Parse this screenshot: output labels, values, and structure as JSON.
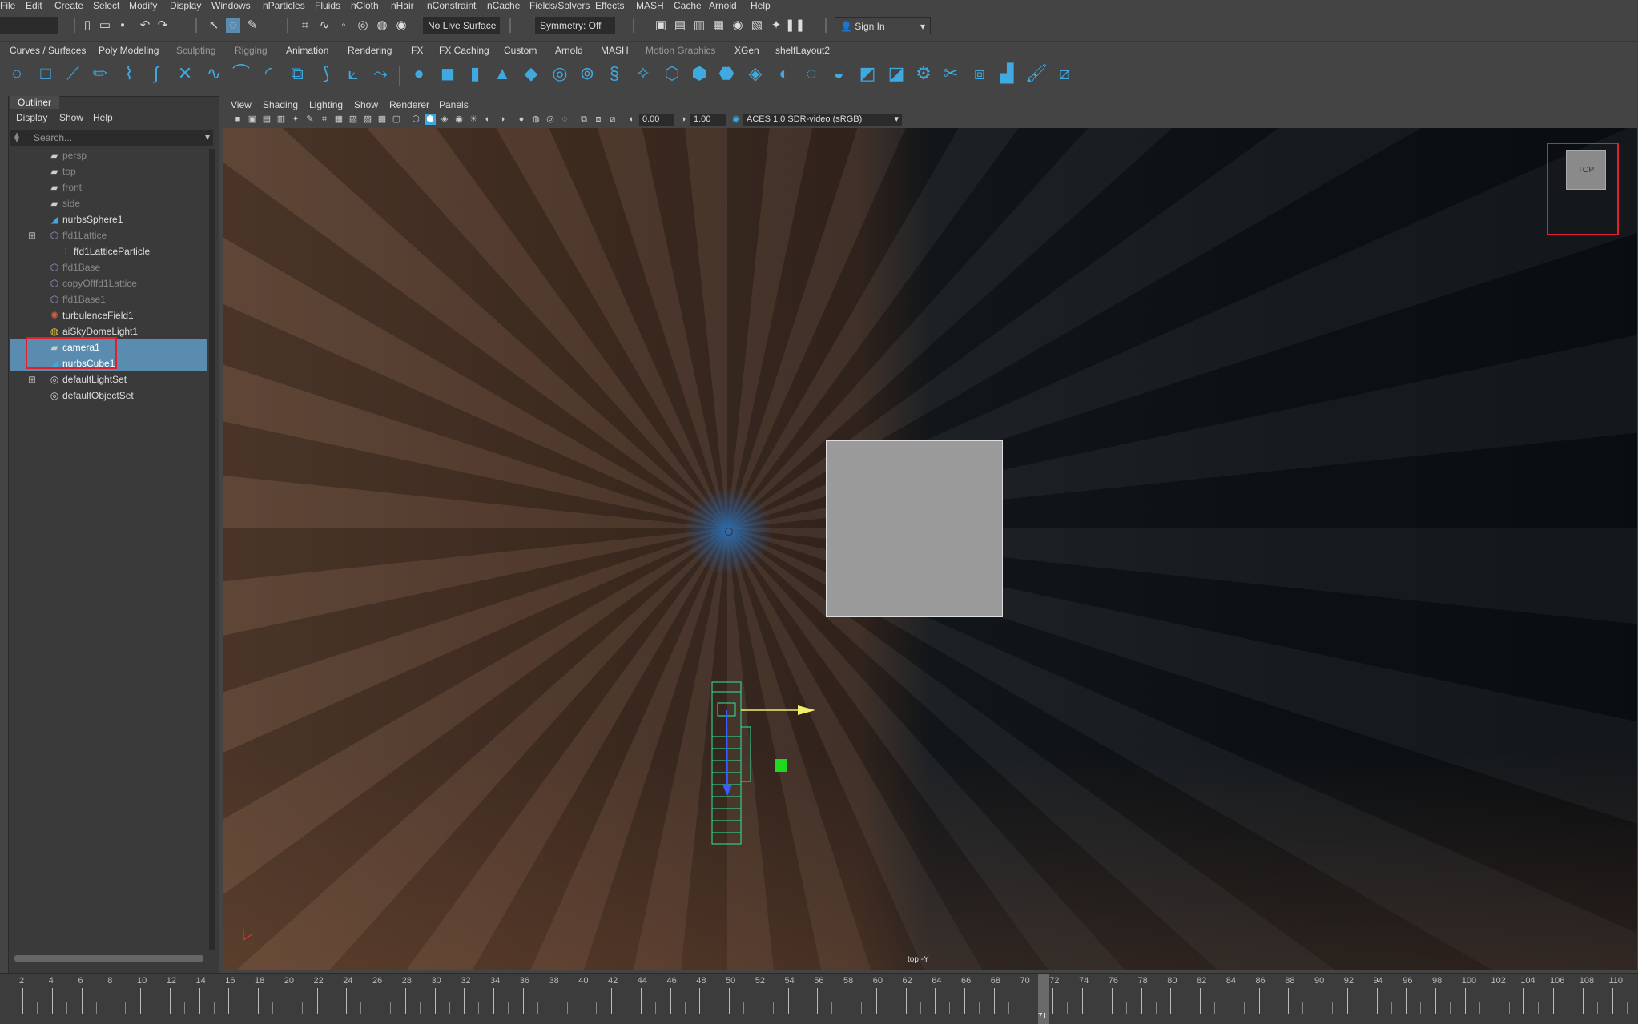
{
  "menubar": [
    "File",
    "Edit",
    "Create",
    "Select",
    "Modify",
    "Display",
    "Windows",
    "nParticles",
    "Fluids",
    "nCloth",
    "nHair",
    "nConstraint",
    "nCache",
    "Fields/Solvers",
    "Effects",
    "MASH",
    "Cache",
    "Arnold",
    "Help"
  ],
  "status": {
    "live_surface": "No Live Surface",
    "symmetry": "Symmetry: Off",
    "sign_in": "Sign In"
  },
  "shelf_tabs": [
    "Curves / Surfaces",
    "Poly Modeling",
    "Sculpting",
    "Rigging",
    "Animation",
    "Rendering",
    "FX",
    "FX Caching",
    "Custom",
    "Arnold",
    "MASH",
    "Motion Graphics",
    "XGen",
    "shelfLayout2"
  ],
  "outliner": {
    "tab": "Outliner",
    "menu": [
      "Display",
      "Show",
      "Help"
    ],
    "search_placeholder": "Search...",
    "items": [
      {
        "label": "persp",
        "dim": true,
        "icon": "camera-icon"
      },
      {
        "label": "top",
        "dim": true,
        "icon": "camera-icon"
      },
      {
        "label": "front",
        "dim": true,
        "icon": "camera-icon"
      },
      {
        "label": "side",
        "dim": true,
        "icon": "camera-icon"
      },
      {
        "label": "nurbsSphere1",
        "dim": false,
        "icon": "nurbs-icon"
      },
      {
        "label": "ffd1Lattice",
        "dim": true,
        "icon": "lattice-icon"
      },
      {
        "label": "ffd1LatticeParticle",
        "dim": false,
        "icon": "particle-icon"
      },
      {
        "label": "ffd1Base",
        "dim": true,
        "icon": "lattice-icon"
      },
      {
        "label": "copyOfffd1Lattice",
        "dim": true,
        "icon": "lattice-icon"
      },
      {
        "label": "ffd1Base1",
        "dim": true,
        "icon": "lattice-icon"
      },
      {
        "label": "turbulenceField1",
        "dim": false,
        "icon": "field-icon"
      },
      {
        "label": "aiSkyDomeLight1",
        "dim": false,
        "icon": "light-icon"
      },
      {
        "label": "camera1",
        "dim": false,
        "icon": "camera-icon",
        "selected": true
      },
      {
        "label": "nurbsCube1",
        "dim": false,
        "icon": "nurbs-icon",
        "selected": true
      },
      {
        "label": "defaultLightSet",
        "dim": false,
        "icon": "set-icon"
      },
      {
        "label": "defaultObjectSet",
        "dim": false,
        "icon": "set-icon"
      }
    ]
  },
  "viewport": {
    "menu": [
      "View",
      "Shading",
      "Lighting",
      "Show",
      "Renderer",
      "Panels"
    ],
    "exposure": "0.00",
    "gamma": "1.00",
    "colorspace": "ACES 1.0 SDR-video (sRGB)",
    "camera_label": "top -Y",
    "viewcube": "TOP"
  },
  "timeline": {
    "labels": [
      "2",
      "4",
      "6",
      "8",
      "10",
      "12",
      "14",
      "16",
      "18",
      "20",
      "22",
      "24",
      "26",
      "28",
      "30",
      "32",
      "34",
      "36",
      "38",
      "40",
      "42",
      "44",
      "46",
      "48",
      "50",
      "52",
      "54",
      "56",
      "58",
      "60",
      "62",
      "64",
      "66",
      "68",
      "70",
      "72",
      "74",
      "76",
      "78",
      "80",
      "82",
      "84",
      "86",
      "88",
      "90",
      "92",
      "94",
      "96",
      "98",
      "100",
      "102",
      "104",
      "106",
      "108",
      "110"
    ],
    "current_frame": "71"
  },
  "colors": {
    "highlight_red": "#e0202a",
    "selection_blue": "#5a8cb0",
    "shelf_blue": "#3fa9e0"
  }
}
